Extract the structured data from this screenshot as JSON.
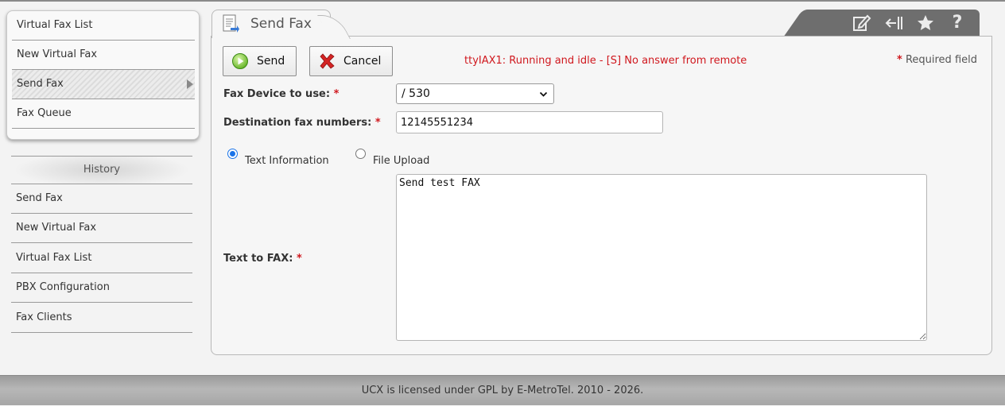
{
  "submenu": {
    "items": [
      {
        "label": "Virtual Fax List"
      },
      {
        "label": "New Virtual Fax"
      },
      {
        "label": "Send Fax"
      },
      {
        "label": "Fax Queue"
      }
    ]
  },
  "history": {
    "title": "History",
    "items": [
      {
        "label": "Send Fax"
      },
      {
        "label": "New Virtual Fax"
      },
      {
        "label": "Virtual Fax List"
      },
      {
        "label": "PBX Configuration"
      },
      {
        "label": "Fax Clients"
      }
    ]
  },
  "module": {
    "title": "Send Fax",
    "toolbar_icons": [
      "edit-icon",
      "collapse-icon",
      "star-icon",
      "help-icon"
    ],
    "help_glyph": "?"
  },
  "form": {
    "send_label": "Send",
    "cancel_label": "Cancel",
    "status_message": "ttyIAX1: Running and idle - [S] No answer from remote",
    "required_star": "*",
    "required_text": "Required field",
    "device_label": "Fax Device to use:",
    "device_value": "/ 530",
    "destination_label": "Destination fax numbers:",
    "destination_value": "12145551234",
    "radio_text_label": "Text Information",
    "radio_file_label": "File Upload",
    "selected_mode": "Text Information",
    "text_label": "Text to FAX:",
    "text_value": "Send test FAX"
  },
  "footer": {
    "text": "UCX is licensed under GPL by E-MetroTel. 2010 - 2026."
  },
  "colors": {
    "error_red": "#d0181e",
    "radio_blue": "#1a73e8",
    "toolbar_gray": "#6e6e6e"
  }
}
